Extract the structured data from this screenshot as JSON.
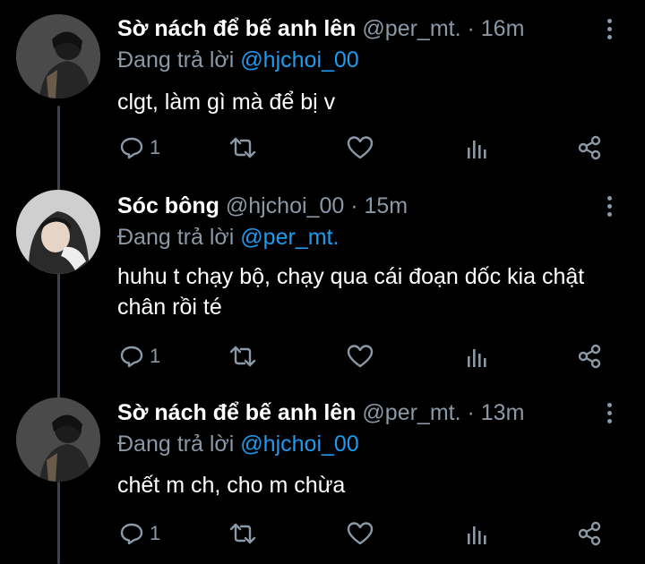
{
  "tweets": [
    {
      "name": "Sờ nách để bế anh lên",
      "handle": "@per_mt.",
      "dot": "·",
      "time": "16m",
      "replying_label": "Đang trả lời",
      "replying_to": "@hjchoi_00",
      "text": "clgt, làm gì mà để bị v",
      "reply_count": "1"
    },
    {
      "name": "Sóc bông",
      "handle": "@hjchoi_00",
      "dot": "·",
      "time": "15m",
      "replying_label": "Đang trả lời",
      "replying_to": "@per_mt.",
      "text": "huhu t chạy bộ, chạy qua cái đoạn dốc kia chật chân rồi té",
      "reply_count": "1"
    },
    {
      "name": "Sờ nách để bế anh lên",
      "handle": "@per_mt.",
      "dot": "·",
      "time": "13m",
      "replying_label": "Đang trả lời",
      "replying_to": "@hjchoi_00",
      "text": "chết m ch, cho m chừa",
      "reply_count": "1"
    }
  ],
  "colors": {
    "background": "#000000",
    "text": "#ffffff",
    "muted": "#8b98a5",
    "mention": "#1d9bf0",
    "thread_line": "#3d4349"
  },
  "icons": [
    "reply-icon",
    "retweet-icon",
    "like-icon",
    "analytics-icon",
    "share-icon",
    "more-icon"
  ]
}
